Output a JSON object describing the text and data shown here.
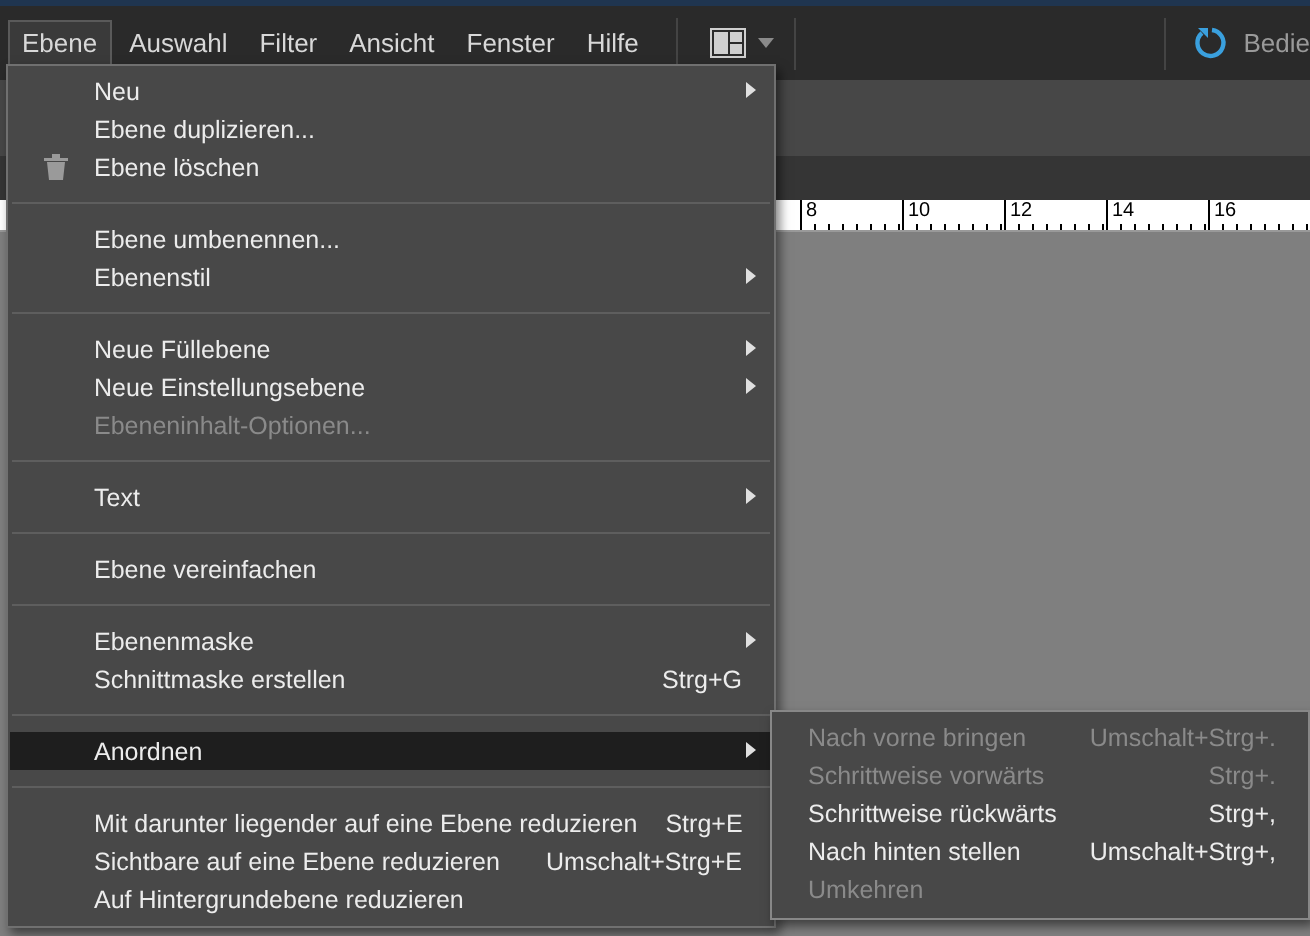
{
  "menubar": {
    "items": [
      {
        "label": "Ebene",
        "selected": true
      },
      {
        "label": "Auswahl",
        "selected": false
      },
      {
        "label": "Filter",
        "selected": false
      },
      {
        "label": "Ansicht",
        "selected": false
      },
      {
        "label": "Fenster",
        "selected": false
      },
      {
        "label": "Hilfe",
        "selected": false
      }
    ],
    "right_label": "Bedie"
  },
  "ruler": {
    "labels": [
      "8",
      "10",
      "12",
      "14",
      "16"
    ]
  },
  "menu": {
    "sections": [
      [
        {
          "label": "Neu",
          "submenu": true,
          "disabled": false,
          "selected": false
        },
        {
          "label": "Ebene duplizieren...",
          "submenu": false,
          "disabled": false,
          "selected": false
        },
        {
          "label": "Ebene löschen",
          "submenu": false,
          "disabled": false,
          "selected": false,
          "has_icon": true
        }
      ],
      [
        {
          "label": "Ebene umbenennen...",
          "submenu": false,
          "disabled": false,
          "selected": false
        },
        {
          "label": "Ebenenstil",
          "submenu": true,
          "disabled": false,
          "selected": false
        }
      ],
      [
        {
          "label": "Neue Füllebene",
          "submenu": true,
          "disabled": false,
          "selected": false
        },
        {
          "label": "Neue Einstellungsebene",
          "submenu": true,
          "disabled": false,
          "selected": false
        },
        {
          "label": "Ebeneninhalt-Optionen...",
          "submenu": false,
          "disabled": true,
          "selected": false
        }
      ],
      [
        {
          "label": "Text",
          "submenu": true,
          "disabled": false,
          "selected": false
        }
      ],
      [
        {
          "label": "Ebene vereinfachen",
          "submenu": false,
          "disabled": false,
          "selected": false
        }
      ],
      [
        {
          "label": "Ebenenmaske",
          "submenu": true,
          "disabled": false,
          "selected": false
        },
        {
          "label": "Schnittmaske erstellen",
          "shortcut": "Strg+G",
          "submenu": false,
          "disabled": false,
          "selected": false
        }
      ],
      [
        {
          "label": "Anordnen",
          "submenu": true,
          "disabled": false,
          "selected": true
        }
      ],
      [
        {
          "label": "Mit darunter liegender auf eine Ebene reduzieren",
          "shortcut": "Strg+E",
          "submenu": false,
          "disabled": false,
          "selected": false
        },
        {
          "label": "Sichtbare auf eine Ebene reduzieren",
          "shortcut": "Umschalt+Strg+E",
          "submenu": false,
          "disabled": false,
          "selected": false
        },
        {
          "label": "Auf Hintergrundebene reduzieren",
          "submenu": false,
          "disabled": false,
          "selected": false
        }
      ]
    ]
  },
  "submenu": {
    "items": [
      {
        "label": "Nach vorne bringen",
        "shortcut": "Umschalt+Strg+.",
        "disabled": true
      },
      {
        "label": "Schrittweise vorwärts",
        "shortcut": "Strg+.",
        "disabled": true
      },
      {
        "label": "Schrittweise rückwärts",
        "shortcut": "Strg+,",
        "disabled": false
      },
      {
        "label": "Nach hinten stellen",
        "shortcut": "Umschalt+Strg+,",
        "disabled": false
      },
      {
        "label": "Umkehren",
        "disabled": true
      }
    ]
  }
}
